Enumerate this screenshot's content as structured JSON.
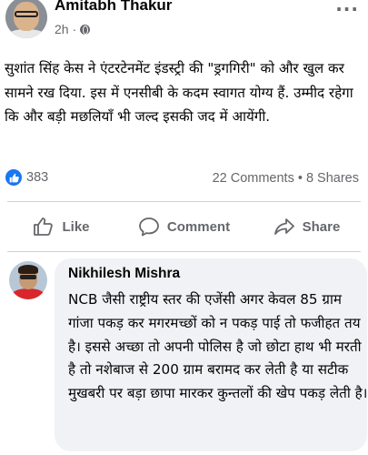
{
  "post": {
    "author": "Amitabh Thakur",
    "time": "2h",
    "separator": "·",
    "more_icon": "more-horizontal-icon",
    "text": "सुशांत सिंह केस ने एंटरटेनमेंट इंडस्ट्री की \"ड्रगगिरी\" को और खुल कर सामने रख दिया. इस में एनसीबी के कदम स्वागत योग्य हैं. उम्मीद रहेगा कि और बड़ी मछलियाँ भी जल्द इसकी जद में आयेंगी."
  },
  "reactions": {
    "count": "383",
    "stats": "22 Comments • 8 Shares"
  },
  "actions": {
    "like": "Like",
    "comment": "Comment",
    "share": "Share"
  },
  "comment": {
    "author": "Nikhilesh Mishra",
    "text": "NCB जैसी राष्ट्रीय स्तर की एजेंसी अगर केवल 85 ग्राम गांजा पकड़ कर मगरमच्छों को न पकड़ पाई तो फजीहत तय है। इससे अच्छा तो अपनी पोलिस है जो छोटा हाथ भी मरती है तो नशेबाज से 200 ग्राम बरामद कर लेती है या सटीक मुखबरी पर बड़ा छापा मारकर कुन्तलों की खेप पकड़ लेती है।"
  },
  "colors": {
    "accent": "#1877f2",
    "muted": "#65676b",
    "bubble": "#f0f2f5"
  }
}
